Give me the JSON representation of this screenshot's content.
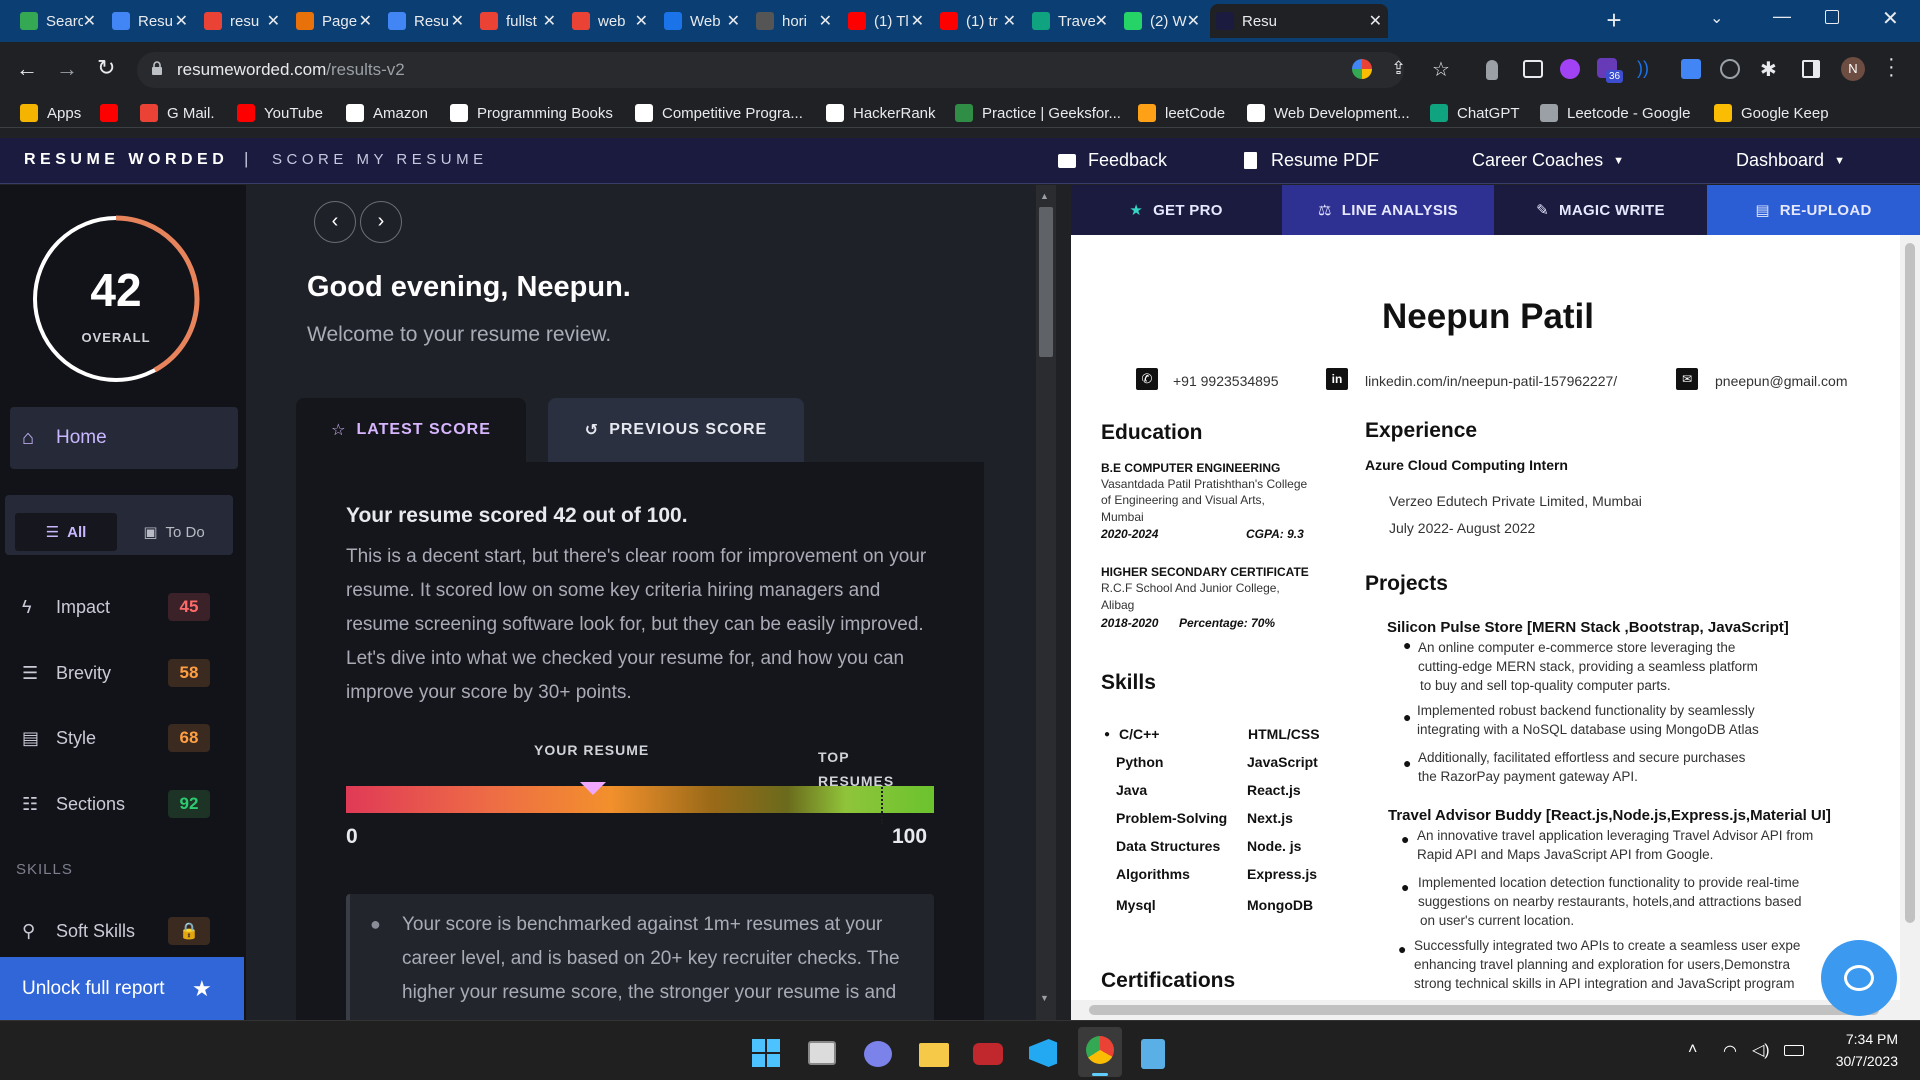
{
  "browser": {
    "tabs": [
      {
        "label": "Searc",
        "icon": "google-drive-icon",
        "color": "#34a853"
      },
      {
        "label": "Resu",
        "icon": "google-docs-icon",
        "color": "#4285f4"
      },
      {
        "label": "resu",
        "icon": "google-icon",
        "color": "#ea4335"
      },
      {
        "label": "Page",
        "icon": "page-icon",
        "color": "#e8710a"
      },
      {
        "label": "Resu",
        "icon": "google-docs-icon",
        "color": "#4285f4"
      },
      {
        "label": "fullst",
        "icon": "google-icon",
        "color": "#ea4335"
      },
      {
        "label": "web",
        "icon": "google-icon",
        "color": "#ea4335"
      },
      {
        "label": "Web",
        "icon": "web-icon",
        "color": "#1a73e8"
      },
      {
        "label": "hori",
        "icon": "css-tricks-icon",
        "color": "#555"
      },
      {
        "label": "(1) Tl",
        "icon": "youtube-icon",
        "color": "#ff0000"
      },
      {
        "label": "(1) tr",
        "icon": "youtube-icon",
        "color": "#ff0000"
      },
      {
        "label": "Trave",
        "icon": "chatgpt-icon",
        "color": "#10a37f"
      },
      {
        "label": "(2) W",
        "icon": "whatsapp-icon",
        "color": "#25d366"
      },
      {
        "label": "Resu",
        "icon": "resume-worded-icon",
        "color": "#1a1b3f"
      }
    ],
    "url_host": "resumeworded.com",
    "url_path": "/results-v2",
    "extension_badge": "36",
    "profile_initial": "N",
    "bookmarks": [
      {
        "label": "Apps",
        "icon": "apps-grid-icon",
        "color": "#f4b400"
      },
      {
        "label": "",
        "icon": "youtube-icon",
        "color": "#ff0000"
      },
      {
        "label": "G Mail.",
        "icon": "gmail-icon",
        "color": "#ea4335"
      },
      {
        "label": "YouTube",
        "icon": "youtube-icon",
        "color": "#ff0000"
      },
      {
        "label": "Amazon",
        "icon": "amazon-icon",
        "color": "#ffffff"
      },
      {
        "label": "Programming Books",
        "icon": "github-icon",
        "color": "#ffffff"
      },
      {
        "label": "Competitive Progra...",
        "icon": "codechef-icon",
        "color": "#ffffff"
      },
      {
        "label": "HackerRank",
        "icon": "hackerrank-icon",
        "color": "#ffffff"
      },
      {
        "label": "Practice | Geeksfor...",
        "icon": "geeksforgeeks-icon",
        "color": "#2f8d46"
      },
      {
        "label": "leetCode",
        "icon": "leetcode-icon",
        "color": "#ffa116"
      },
      {
        "label": "Web Development...",
        "icon": "web-dev-icon",
        "color": "#ffffff"
      },
      {
        "label": "ChatGPT",
        "icon": "chatgpt-icon",
        "color": "#10a37f"
      },
      {
        "label": "Leetcode - Google",
        "icon": "globe-icon",
        "color": "#9aa0a6"
      },
      {
        "label": "Google Keep",
        "icon": "google-keep-icon",
        "color": "#fbbc04"
      }
    ]
  },
  "site": {
    "brand": "RESUME WORDED",
    "divider": "|",
    "subtitle": "SCORE MY RESUME",
    "nav": {
      "feedback": "Feedback",
      "resume_pdf": "Resume PDF",
      "career_coaches": "Career Coaches",
      "dashboard": "Dashboard"
    }
  },
  "sidebar": {
    "score": "42",
    "score_label": "OVERALL",
    "score_fraction": 0.42,
    "home": "Home",
    "filter_all": "All",
    "filter_todo": "To Do",
    "items": [
      {
        "label": "Impact",
        "score": "45",
        "icon": "bolt-icon",
        "color": "#ff6b6b",
        "bg": "#3a2228"
      },
      {
        "label": "Brevity",
        "score": "58",
        "icon": "list-icon",
        "color": "#ff9f43",
        "bg": "#3a2a20"
      },
      {
        "label": "Style",
        "score": "68",
        "icon": "document-icon",
        "color": "#ff9f43",
        "bg": "#3a2a20"
      },
      {
        "label": "Sections",
        "score": "92",
        "icon": "sections-icon",
        "color": "#2ecc71",
        "bg": "#1c3325"
      }
    ],
    "skills_heading": "SKILLS",
    "soft_skills": "Soft Skills",
    "unlock": "Unlock full report"
  },
  "main": {
    "greeting": "Good evening, Neepun.",
    "welcome": "Welcome to your resume review.",
    "tab_latest": "LATEST SCORE",
    "tab_previous": "PREVIOUS SCORE",
    "score_heading": "Your resume scored 42 out of 100.",
    "description": "This is a decent start, but there's clear room for improvement on your resume. It scored low on some key criteria hiring managers and resume screening software look for, but they can be easily improved. Let's dive into what we checked your resume for, and how you can improve your score by 30+ points.",
    "bar_label_yours": "YOUR RESUME",
    "bar_label_top": "TOP RESUMES",
    "bar_min": "0",
    "bar_max": "100",
    "bar_marker_value": 42,
    "bar_top_value": 91,
    "benchmark": "Your score is benchmarked against 1m+ resumes at your career level, and is based on 20+ key recruiter checks. The higher your resume score, the stronger your resume is and"
  },
  "resume_tabs": {
    "get_pro": "GET PRO",
    "line_analysis": "LINE ANALYSIS",
    "magic_write": "MAGIC WRITE",
    "reupload": "RE-UPLOAD"
  },
  "resume": {
    "name": "Neepun Patil",
    "phone": "+91 9923534895",
    "linkedin": "linkedin.com/in/neepun-patil-157962227/",
    "email": "pneepun@gmail.com",
    "education_heading": "Education",
    "edu1_title": "B.E  COMPUTER ENGINEERING",
    "edu1_school1": "Vasantdada Patil Pratishthan's College",
    "edu1_school2": "of Engineering and Visual Arts,",
    "edu1_school3": "Mumbai",
    "edu1_years": "2020-2024",
    "edu1_cgpa": "CGPA: 9.3",
    "edu2_title": "HIGHER SECONDARY CERTIFICATE",
    "edu2_school1": "R.C.F School And Junior College,",
    "edu2_school2": "Alibag",
    "edu2_years": "2018-2020",
    "edu2_pct": "Percentage: 70%",
    "skills_heading": "Skills",
    "skills_col1": [
      "C/C++",
      "Python",
      "Java",
      "Problem-Solving",
      "Data Structures",
      "Algorithms",
      "Mysql"
    ],
    "skills_col2": [
      "HTML/CSS",
      "JavaScript",
      "React.js",
      "Next.js",
      "Node. js",
      "Express.js",
      "MongoDB"
    ],
    "certifications_heading": "Certifications",
    "experience_heading": "Experience",
    "exp_role": "Azure Cloud Computing Intern",
    "exp_company": "Verzeo Edutech Private Limited, Mumbai",
    "exp_dates": "July 2022- August 2022",
    "projects_heading": "Projects",
    "proj1_title": "Silicon Pulse Store  [MERN Stack ,Bootstrap, JavaScript]",
    "proj1_b1_l1": "An online computer e-commerce store leveraging the",
    "proj1_b1_l2": "cutting-edge MERN stack, providing a seamless platform",
    "proj1_b1_l3": "to buy and sell top-quality computer parts.",
    "proj1_b2_l1": "Implemented robust backend functionality by seamlessly",
    "proj1_b2_l2": "integrating with a NoSQL database using MongoDB Atlas",
    "proj1_b3_l1": "Additionally, facilitated effortless and secure purchases",
    "proj1_b3_l2": "the RazorPay payment gateway API.",
    "proj2_title": "Travel Advisor Buddy  [React.js,Node.js,Express.js,Material UI]",
    "proj2_b1_l1": "An innovative travel application leveraging Travel Advisor API from",
    "proj2_b1_l2": "Rapid API and Maps JavaScript API from Google.",
    "proj2_b2_l1": "Implemented location detection functionality to provide real-time",
    "proj2_b2_l2": "suggestions on nearby restaurants, hotels,and attractions based",
    "proj2_b2_l3": "on user's current location.",
    "proj3_b1_l1": "Successfully integrated two APIs to create a seamless user expe",
    "proj3_b1_l2": "enhancing travel planning and exploration for users,Demonstra",
    "proj3_b1_l3": "strong technical skills in API integration and JavaScript program"
  },
  "taskbar": {
    "time": "7:34 PM",
    "date": "30/7/2023",
    "apps": [
      "windows-start-icon",
      "task-view-icon",
      "teams-chat-icon",
      "file-explorer-icon",
      "game-app-icon",
      "vscode-icon",
      "chrome-icon",
      "notepad-icon"
    ]
  }
}
